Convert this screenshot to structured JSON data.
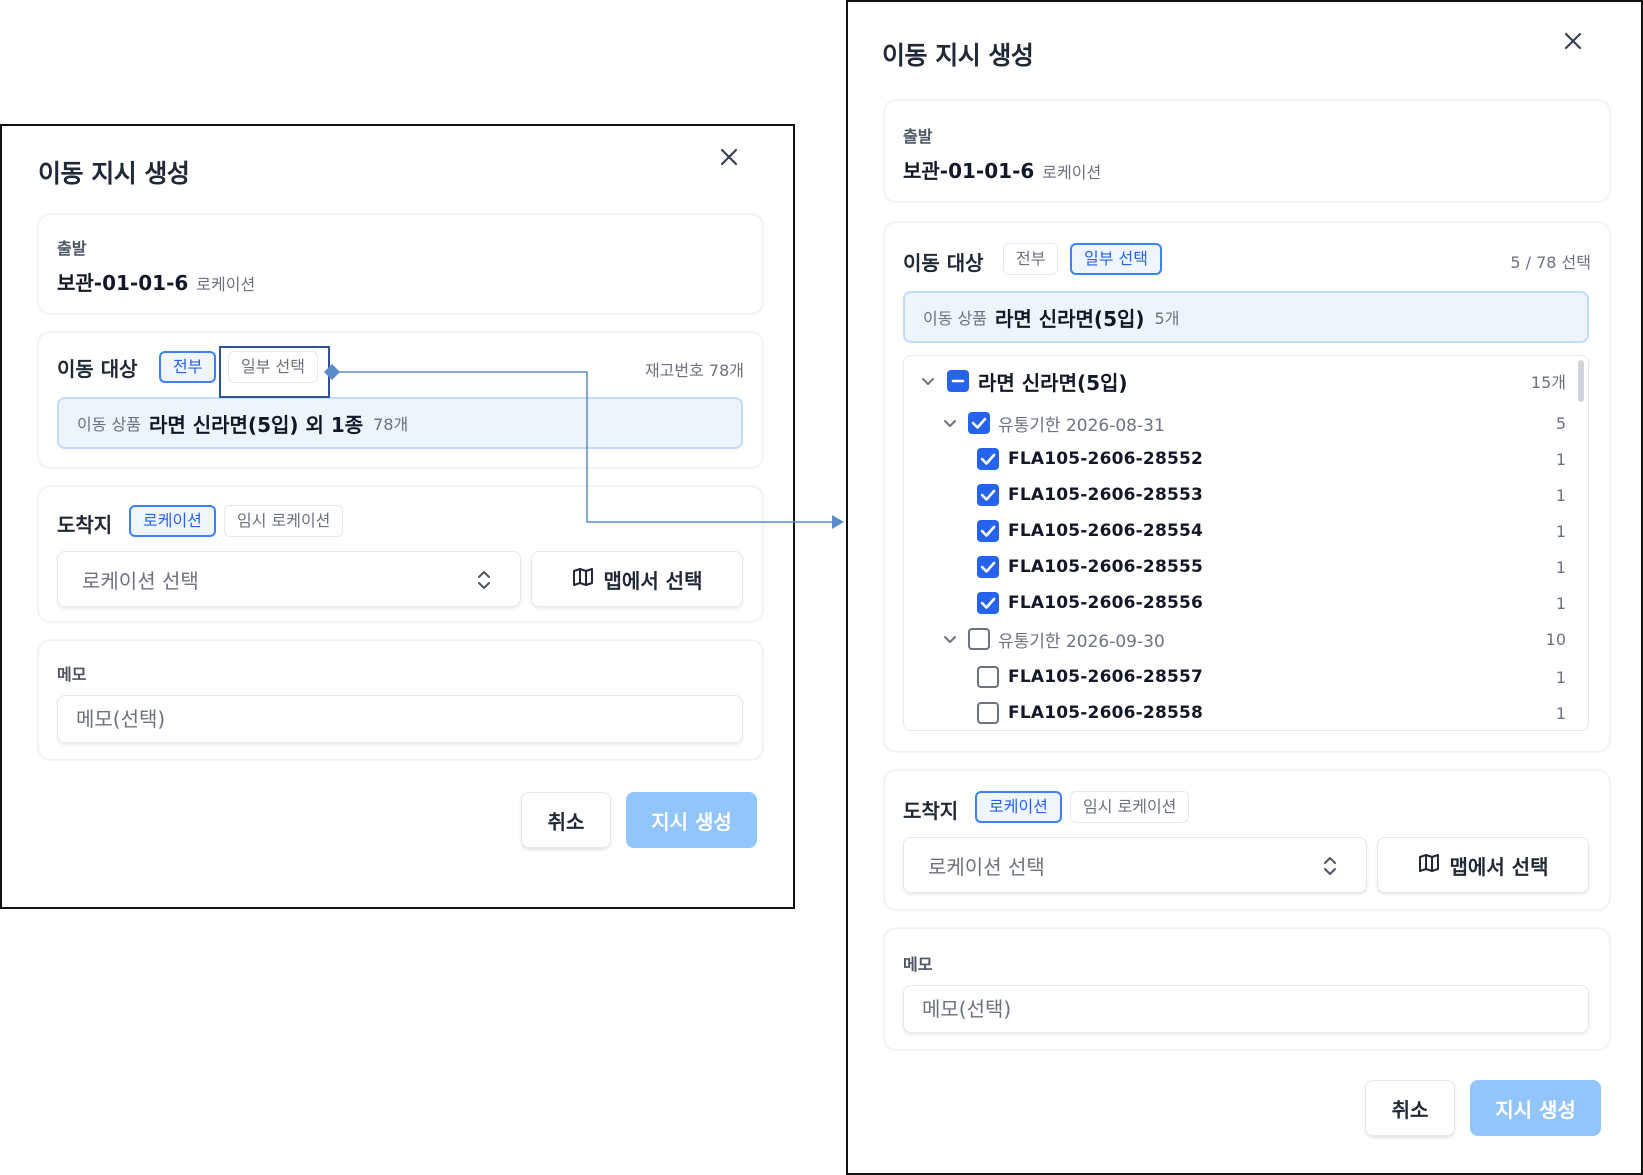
{
  "dialog_title": "이동 지시 생성",
  "origin": {
    "label": "출발",
    "location_name": "보관-01-01-6",
    "location_type": "로케이션"
  },
  "left": {
    "target": {
      "label": "이동 대상",
      "tab_all": "전부",
      "tab_partial": "일부 선택",
      "selected_tab": "전부",
      "count_text": "재고번호 78개",
      "box_label": "이동 상품",
      "box_value": "라면 신라면(5입) 외 1종",
      "box_count": "78개"
    }
  },
  "right": {
    "target": {
      "label": "이동 대상",
      "tab_all": "전부",
      "tab_partial": "일부 선택",
      "selected_tab": "일부 선택",
      "count_text": "5 / 78 선택",
      "box_label": "이동 상품",
      "box_value": "라면 신라면(5입)",
      "box_count": "5개"
    },
    "tree": {
      "product": {
        "name": "라면 신라면(5입)",
        "count": "15개",
        "state": "indeterminate",
        "expanded": true
      },
      "groups": [
        {
          "label": "유통기한 2026-08-31",
          "count": "5",
          "checked": true,
          "expanded": true,
          "items": [
            {
              "code": "FLA105-2606-28552",
              "count": "1",
              "checked": true
            },
            {
              "code": "FLA105-2606-28553",
              "count": "1",
              "checked": true
            },
            {
              "code": "FLA105-2606-28554",
              "count": "1",
              "checked": true
            },
            {
              "code": "FLA105-2606-28555",
              "count": "1",
              "checked": true
            },
            {
              "code": "FLA105-2606-28556",
              "count": "1",
              "checked": true
            }
          ]
        },
        {
          "label": "유통기한 2026-09-30",
          "count": "10",
          "checked": false,
          "expanded": true,
          "items": [
            {
              "code": "FLA105-2606-28557",
              "count": "1",
              "checked": false
            },
            {
              "code": "FLA105-2606-28558",
              "count": "1",
              "checked": false
            }
          ]
        }
      ]
    }
  },
  "destination": {
    "label": "도착지",
    "tab_location": "로케이션",
    "tab_temp": "임시 로케이션",
    "selected_tab": "로케이션",
    "select_placeholder": "로케이션 선택",
    "map_button": "맵에서 선택"
  },
  "memo": {
    "label": "메모",
    "placeholder": "메모(선택)"
  },
  "buttons": {
    "cancel": "취소",
    "submit": "지시 생성"
  },
  "colors": {
    "accent": "#3b82f6",
    "submit_disabled": "#93c5fd",
    "target_box_bg": "#eef4fc",
    "annotation": "#2f5597",
    "connector": "#5b8cc9"
  },
  "icons": {
    "close": "close-icon",
    "chevron_updown": "chevron-up-down-icon",
    "map": "map-icon",
    "chevron_down": "chevron-down-icon"
  }
}
